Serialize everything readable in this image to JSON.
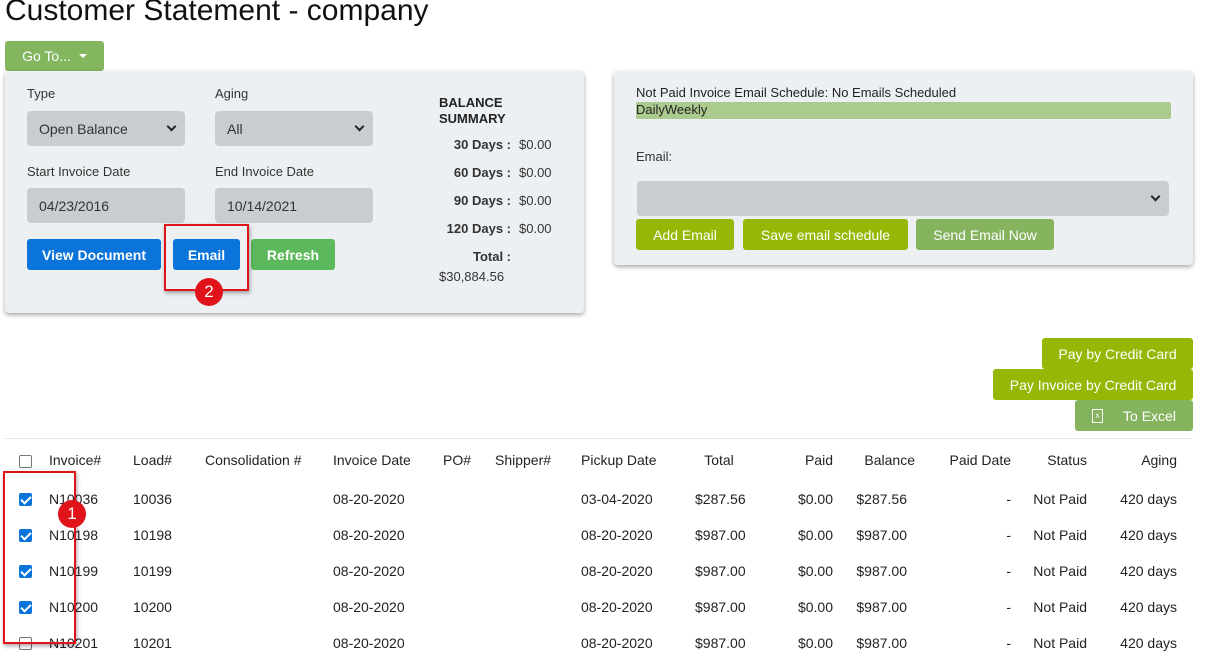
{
  "page": {
    "title": "Customer Statement - company"
  },
  "goto": {
    "label": "Go To..."
  },
  "filters": {
    "type_label": "Type",
    "type_value": "Open Balance",
    "aging_label": "Aging",
    "aging_value": "All",
    "start_label": "Start Invoice Date",
    "start_value": "04/23/2016",
    "end_label": "End Invoice Date",
    "end_value": "10/14/2021",
    "view_document": "View Document",
    "email": "Email",
    "refresh": "Refresh"
  },
  "balance_summary": {
    "heading_line1": "BALANCE",
    "heading_line2": "SUMMARY",
    "rows": [
      {
        "label": "30 Days :",
        "value": "$0.00"
      },
      {
        "label": "60 Days :",
        "value": "$0.00"
      },
      {
        "label": "90 Days :",
        "value": "$0.00"
      },
      {
        "label": "120 Days :",
        "value": "$0.00"
      }
    ],
    "total_label": "Total :",
    "total_value": "$30,884.56"
  },
  "email_schedule": {
    "status_text": "Not Paid Invoice Email Schedule: No Emails Scheduled",
    "frequency_options": "DailyWeekly",
    "email_label": "Email:",
    "email_value": "",
    "add_email": "Add Email",
    "save_schedule": "Save email schedule",
    "send_now": "Send Email Now"
  },
  "actions": {
    "pay_cc": "Pay by Credit Card",
    "pay_invoice_cc": "Pay Invoice by Credit Card",
    "to_excel": "To Excel"
  },
  "annotations": {
    "badge1": "1",
    "badge2": "2"
  },
  "table": {
    "headers": [
      "Invoice#",
      "Load#",
      "Consolidation #",
      "Invoice Date",
      "PO#",
      "Shipper#",
      "Pickup Date",
      "Total",
      "Paid",
      "Balance",
      "Paid Date",
      "Status",
      "Aging"
    ],
    "rows": [
      {
        "checked": true,
        "invoice": "N10036",
        "load": "10036",
        "consolidation": "",
        "invoice_date": "08-20-2020",
        "po": "",
        "shipper": "",
        "pickup_date": "03-04-2020",
        "total": "$287.56",
        "paid": "$0.00",
        "balance": "$287.56",
        "paid_date": "-",
        "status": "Not Paid",
        "aging": "420 days"
      },
      {
        "checked": true,
        "invoice": "N10198",
        "load": "10198",
        "consolidation": "",
        "invoice_date": "08-20-2020",
        "po": "",
        "shipper": "",
        "pickup_date": "08-20-2020",
        "total": "$987.00",
        "paid": "$0.00",
        "balance": "$987.00",
        "paid_date": "-",
        "status": "Not Paid",
        "aging": "420 days"
      },
      {
        "checked": true,
        "invoice": "N10199",
        "load": "10199",
        "consolidation": "",
        "invoice_date": "08-20-2020",
        "po": "",
        "shipper": "",
        "pickup_date": "08-20-2020",
        "total": "$987.00",
        "paid": "$0.00",
        "balance": "$987.00",
        "paid_date": "-",
        "status": "Not Paid",
        "aging": "420 days"
      },
      {
        "checked": true,
        "invoice": "N10200",
        "load": "10200",
        "consolidation": "",
        "invoice_date": "08-20-2020",
        "po": "",
        "shipper": "",
        "pickup_date": "08-20-2020",
        "total": "$987.00",
        "paid": "$0.00",
        "balance": "$987.00",
        "paid_date": "-",
        "status": "Not Paid",
        "aging": "420 days"
      },
      {
        "checked": false,
        "invoice": "N10201",
        "load": "10201",
        "consolidation": "",
        "invoice_date": "08-20-2020",
        "po": "",
        "shipper": "",
        "pickup_date": "08-20-2020",
        "total": "$987.00",
        "paid": "$0.00",
        "balance": "$987.00",
        "paid_date": "-",
        "status": "Not Paid",
        "aging": "420 days"
      }
    ]
  }
}
